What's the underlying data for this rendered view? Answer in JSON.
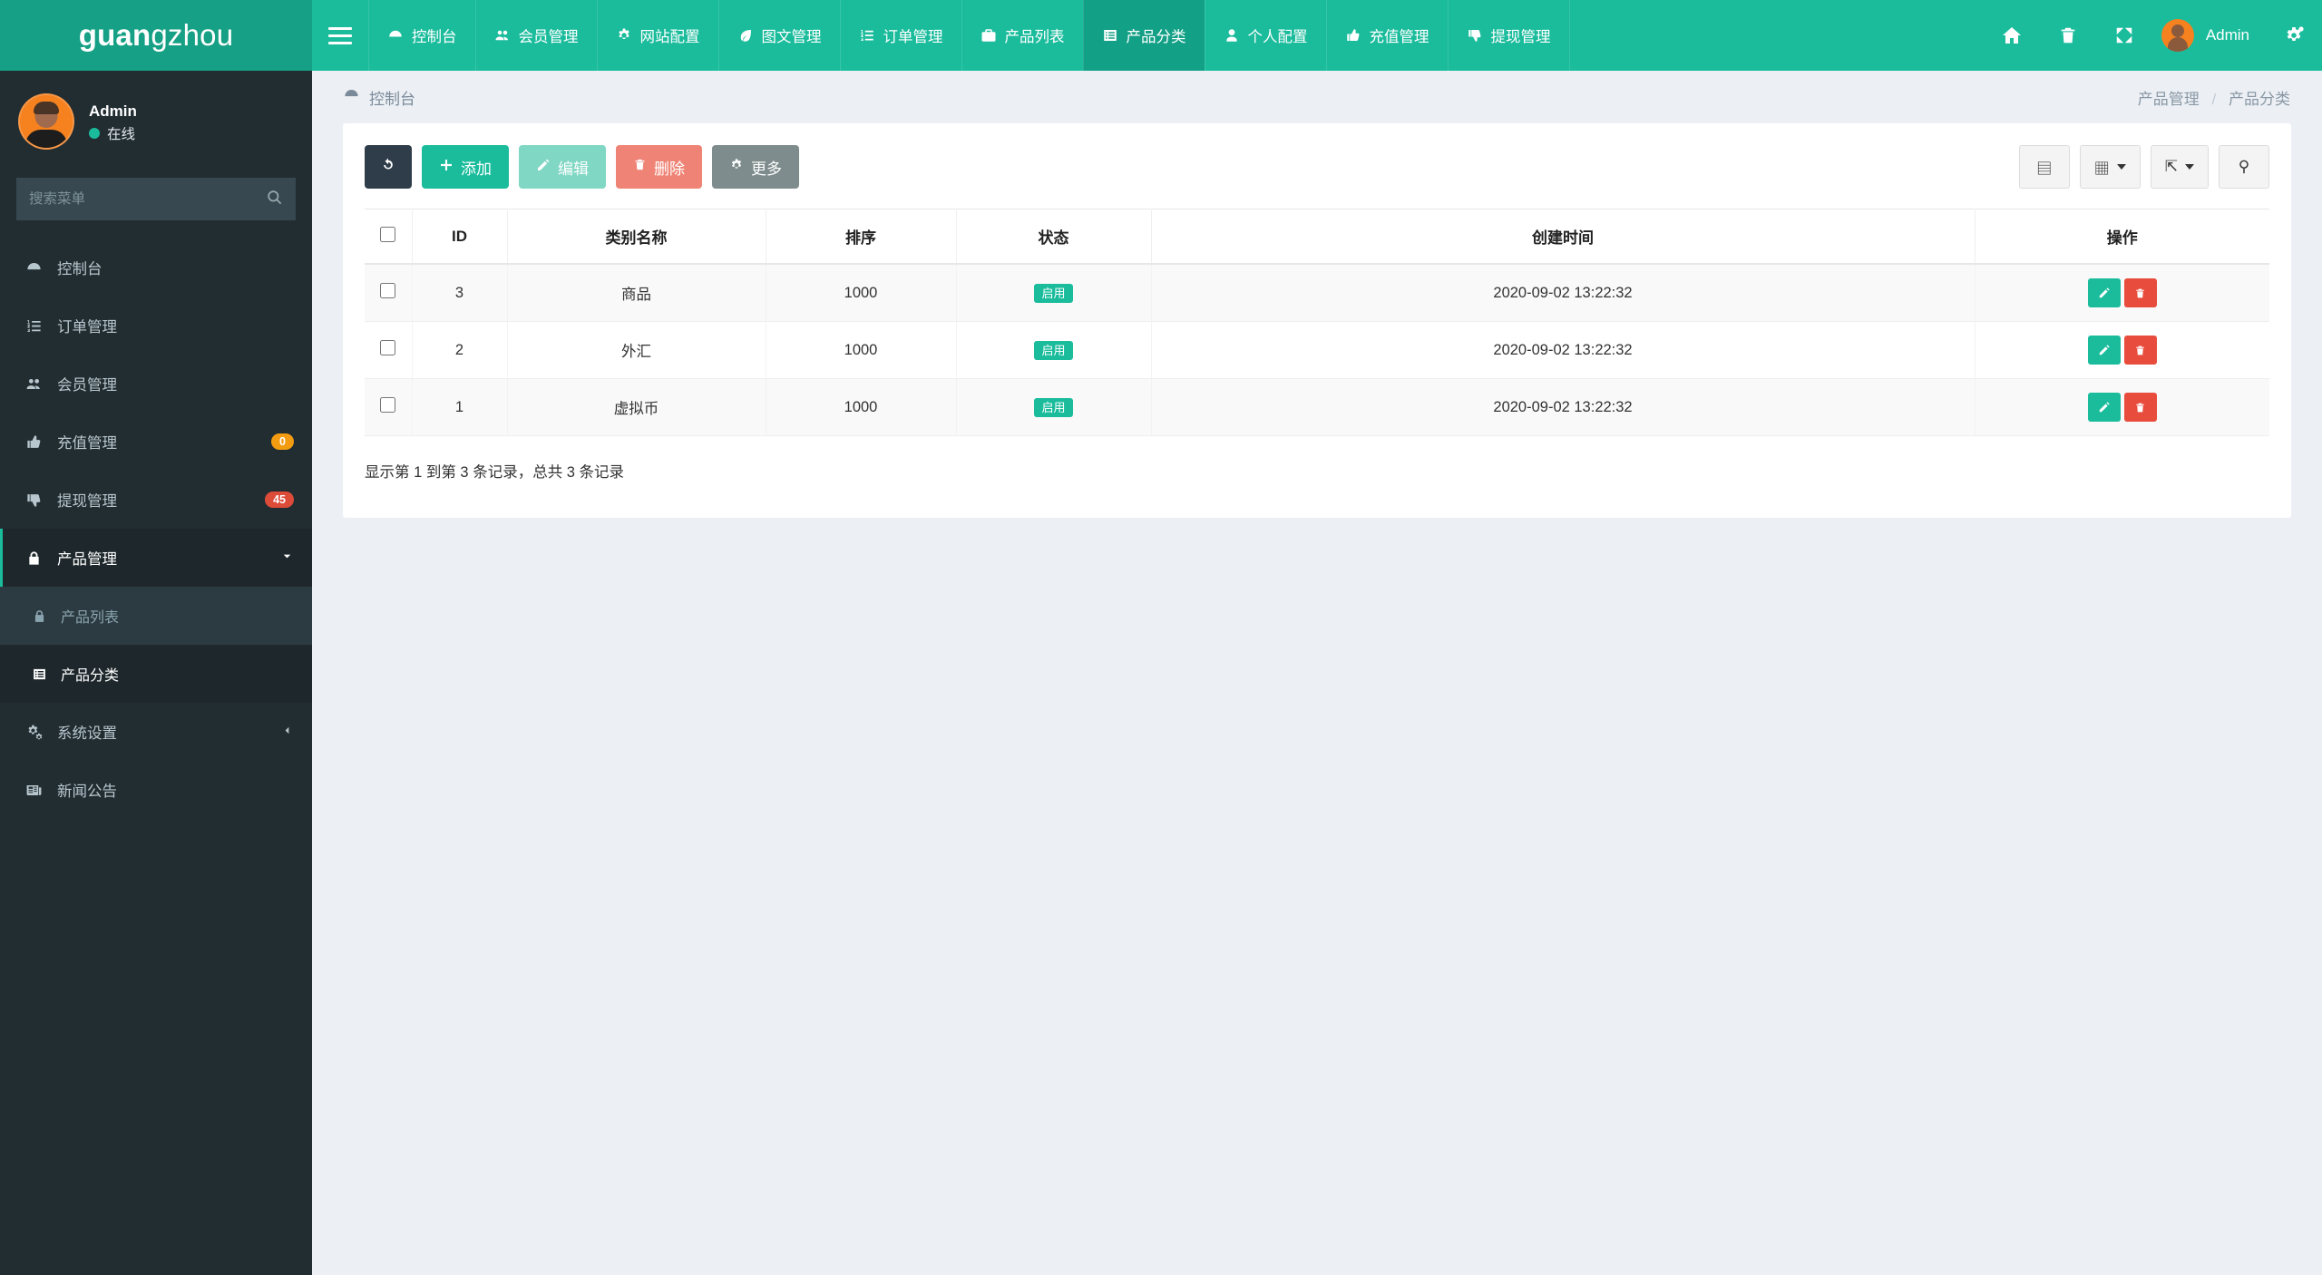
{
  "logo": {
    "bold": "guan",
    "light": "gzhou"
  },
  "navbar": {
    "toggle_label": "menu-toggle",
    "items": [
      {
        "label": "控制台",
        "icon": "dashboard-icon",
        "active": false
      },
      {
        "label": "会员管理",
        "icon": "users-icon",
        "active": false
      },
      {
        "label": "网站配置",
        "icon": "gear-icon",
        "active": false
      },
      {
        "label": "图文管理",
        "icon": "leaf-icon",
        "active": false
      },
      {
        "label": "订单管理",
        "icon": "list-ol-icon",
        "active": false
      },
      {
        "label": "产品列表",
        "icon": "briefcase-icon",
        "active": false
      },
      {
        "label": "产品分类",
        "icon": "list-alt-icon",
        "active": true
      },
      {
        "label": "个人配置",
        "icon": "user-icon",
        "active": false
      },
      {
        "label": "充值管理",
        "icon": "thumbs-up-icon",
        "active": false
      },
      {
        "label": "提现管理",
        "icon": "thumbs-down-icon",
        "active": false
      }
    ],
    "right_icons": [
      {
        "name": "home-icon"
      },
      {
        "name": "trash-icon"
      },
      {
        "name": "fullscreen-icon"
      }
    ],
    "user": {
      "name": "Admin"
    },
    "settings_icon": "gears-icon"
  },
  "sidebar": {
    "user": {
      "name": "Admin",
      "status": "在线"
    },
    "search": {
      "placeholder": "搜索菜单",
      "value": "",
      "icon": "search-icon"
    },
    "items": [
      {
        "label": "控制台",
        "icon": "dashboard-icon",
        "badge": null,
        "state": "normal"
      },
      {
        "label": "订单管理",
        "icon": "list-ol-icon",
        "badge": null,
        "state": "normal"
      },
      {
        "label": "会员管理",
        "icon": "users-icon",
        "badge": null,
        "state": "normal"
      },
      {
        "label": "充值管理",
        "icon": "thumbs-up-icon",
        "badge": {
          "text": "0",
          "color": "orange"
        },
        "state": "normal"
      },
      {
        "label": "提现管理",
        "icon": "thumbs-down-icon",
        "badge": {
          "text": "45",
          "color": "red"
        },
        "state": "normal"
      },
      {
        "label": "产品管理",
        "icon": "lock-icon",
        "badge": null,
        "state": "open",
        "chevron": "chevron-down-icon"
      },
      {
        "label": "系统设置",
        "icon": "cogs-icon",
        "badge": null,
        "state": "normal",
        "chevron": "chevron-left-icon"
      },
      {
        "label": "新闻公告",
        "icon": "newspaper-icon",
        "badge": null,
        "state": "normal"
      }
    ],
    "submenu": [
      {
        "label": "产品列表",
        "icon": "lock-icon",
        "active": false
      },
      {
        "label": "产品分类",
        "icon": "list-alt-icon",
        "active": true
      }
    ]
  },
  "breadcrumb": {
    "left_icon": "dashboard-icon",
    "left_label": "控制台",
    "right_parent": "产品管理",
    "right_separator": "/",
    "right_current": "产品分类"
  },
  "toolbar": {
    "refresh_label": "",
    "refresh_icon": "refresh-icon",
    "add_label": "添加",
    "edit_label": "编辑",
    "delete_label": "删除",
    "more_label": "更多",
    "right_buttons": [
      {
        "name": "column-toggle-icon",
        "glyph": "▤",
        "caret": false
      },
      {
        "name": "grid-view-icon",
        "glyph": "▦",
        "caret": true
      },
      {
        "name": "export-icon",
        "glyph": "⇱",
        "caret": true
      },
      {
        "name": "search-icon",
        "glyph": "⚲",
        "caret": false
      }
    ]
  },
  "table": {
    "columns": [
      "",
      "ID",
      "类别名称",
      "排序",
      "状态",
      "创建时间",
      "操作"
    ],
    "rows": [
      {
        "id": "3",
        "name": "商品",
        "sort": "1000",
        "status": "启用",
        "created": "2020-09-02 13:22:32"
      },
      {
        "id": "2",
        "name": "外汇",
        "sort": "1000",
        "status": "启用",
        "created": "2020-09-02 13:22:32"
      },
      {
        "id": "1",
        "name": "虚拟币",
        "sort": "1000",
        "status": "启用",
        "created": "2020-09-02 13:22:32"
      }
    ],
    "footer": "显示第 1 到第 3 条记录，总共 3 条记录",
    "row_action_edit": "edit-row-button",
    "row_action_delete": "delete-row-button"
  },
  "colors": {
    "brand": "#1abc9c",
    "logo_bg": "#16a085",
    "sidebar_bg": "#222d32",
    "content_bg": "#ecf0f5",
    "badge_orange": "#f39c12",
    "badge_red": "#dd4b39",
    "danger": "#e74c3c"
  }
}
